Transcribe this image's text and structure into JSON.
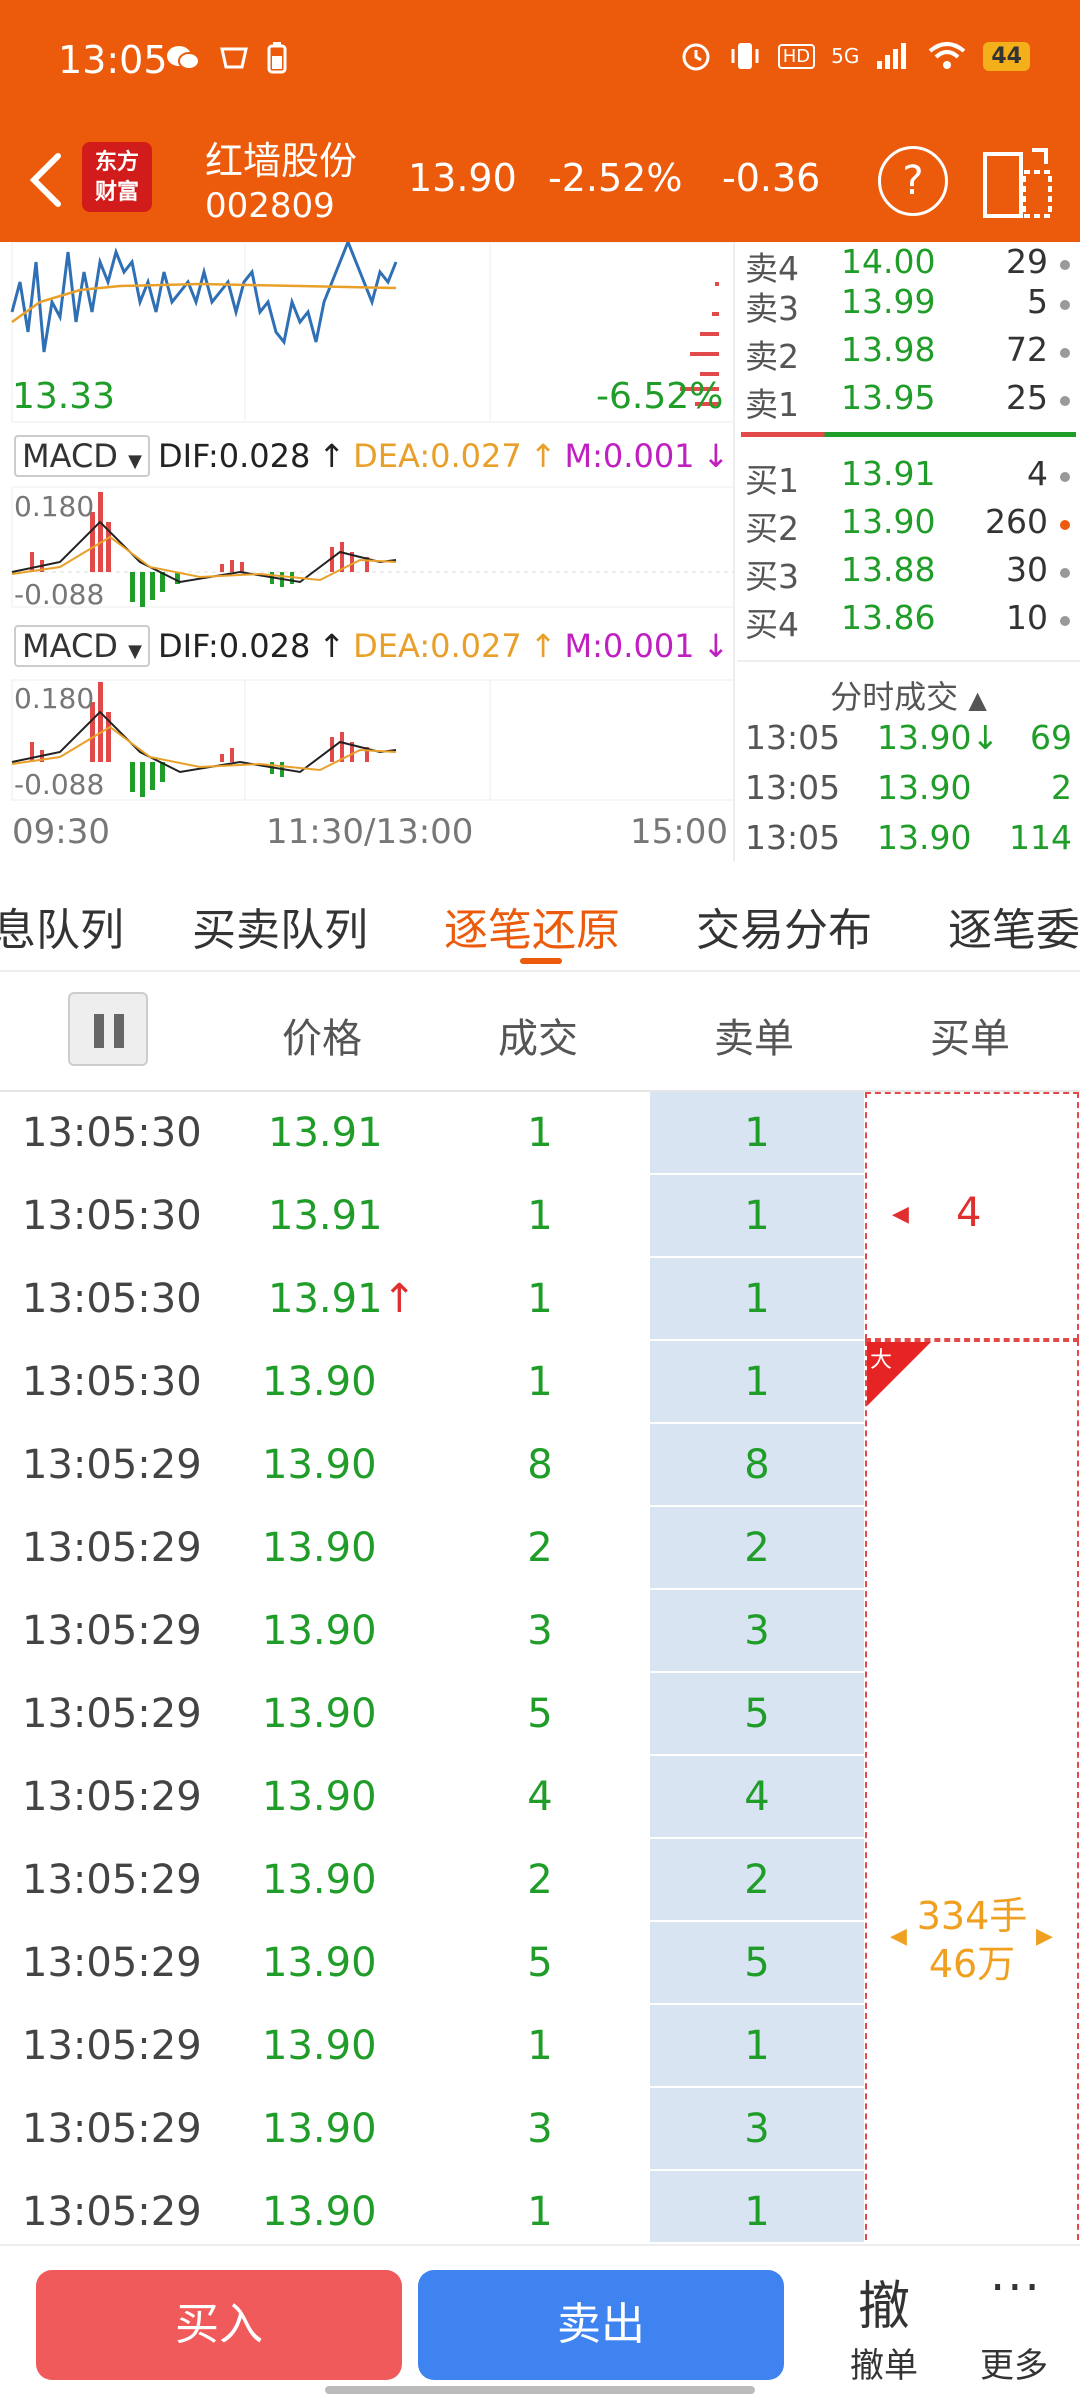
{
  "status_bar": {
    "time": "13:05",
    "network": "5G",
    "hd": "HD",
    "battery": "44"
  },
  "header": {
    "logo_line1": "东方",
    "logo_line2": "财富",
    "stock_name": "红墙股份",
    "stock_code": "002809",
    "price": "13.90",
    "change_pct": "-2.52%",
    "change": "-0.36",
    "help_label": "?"
  },
  "chart": {
    "low_price": "13.33",
    "low_pct": "-6.52%",
    "x_labels": [
      "09:30",
      "11:30/13:00",
      "15:00"
    ],
    "macd_panels": [
      {
        "selector": "MACD",
        "dif": "DIF:0.028",
        "dea": "DEA:0.027",
        "m": "M:0.001",
        "top": "0.180",
        "bottom": "-0.088"
      },
      {
        "selector": "MACD",
        "dif": "DIF:0.028",
        "dea": "DEA:0.027",
        "m": "M:0.001",
        "top": "0.180",
        "bottom": "-0.088"
      }
    ],
    "colors": {
      "price_line": "#2f6fb5",
      "avg_line": "#e8a02a",
      "up": "#e24a4a",
      "down": "#1f9d28"
    }
  },
  "orderbook": {
    "asks": [
      {
        "label": "卖4",
        "price": "14.00",
        "vol": "29"
      },
      {
        "label": "卖3",
        "price": "13.99",
        "vol": "5"
      },
      {
        "label": "卖2",
        "price": "13.98",
        "vol": "72"
      },
      {
        "label": "卖1",
        "price": "13.95",
        "vol": "25"
      }
    ],
    "bids": [
      {
        "label": "买1",
        "price": "13.91",
        "vol": "4"
      },
      {
        "label": "买2",
        "price": "13.90",
        "vol": "260"
      },
      {
        "label": "买3",
        "price": "13.88",
        "vol": "30"
      },
      {
        "label": "买4",
        "price": "13.86",
        "vol": "10"
      }
    ],
    "trades_title": "分时成交",
    "trades": [
      {
        "time": "13:05",
        "price": "13.90↓",
        "vol": "69"
      },
      {
        "time": "13:05",
        "price": "13.90",
        "vol": "2"
      },
      {
        "time": "13:05",
        "price": "13.90",
        "vol": "114"
      }
    ]
  },
  "tabs": [
    {
      "label": "息队列"
    },
    {
      "label": "买卖队列"
    },
    {
      "label": "逐笔还原"
    },
    {
      "label": "交易分布"
    },
    {
      "label": "逐笔委"
    }
  ],
  "table": {
    "headers": [
      "价格",
      "成交",
      "卖单",
      "买单"
    ],
    "rows": [
      {
        "time": "13:05:30",
        "price": "13.91",
        "vol": "1",
        "sell": "1"
      },
      {
        "time": "13:05:30",
        "price": "13.91",
        "vol": "1",
        "sell": "1"
      },
      {
        "time": "13:05:30",
        "price": "13.91↑",
        "vol": "1",
        "sell": "1"
      },
      {
        "time": "13:05:30",
        "price": "13.90",
        "vol": "1",
        "sell": "1"
      },
      {
        "time": "13:05:29",
        "price": "13.90",
        "vol": "8",
        "sell": "8"
      },
      {
        "time": "13:05:29",
        "price": "13.90",
        "vol": "2",
        "sell": "2"
      },
      {
        "time": "13:05:29",
        "price": "13.90",
        "vol": "3",
        "sell": "3"
      },
      {
        "time": "13:05:29",
        "price": "13.90",
        "vol": "5",
        "sell": "5"
      },
      {
        "time": "13:05:29",
        "price": "13.90",
        "vol": "4",
        "sell": "4"
      },
      {
        "time": "13:05:29",
        "price": "13.90",
        "vol": "2",
        "sell": "2"
      },
      {
        "time": "13:05:29",
        "price": "13.90",
        "vol": "5",
        "sell": "5"
      },
      {
        "time": "13:05:29",
        "price": "13.90",
        "vol": "1",
        "sell": "1"
      },
      {
        "time": "13:05:29",
        "price": "13.90",
        "vol": "3",
        "sell": "3"
      },
      {
        "time": "13:05:29",
        "price": "13.90",
        "vol": "1",
        "sell": "1"
      }
    ],
    "buy_box1": "4",
    "big_badge": "大",
    "buy_box2_line1": "334手",
    "buy_box2_line2": "46万"
  },
  "bottom": {
    "buy": "买入",
    "sell": "卖出",
    "cancel_glyph": "撤",
    "cancel_label": "撤单",
    "more_glyph": "···",
    "more_label": "更多"
  }
}
